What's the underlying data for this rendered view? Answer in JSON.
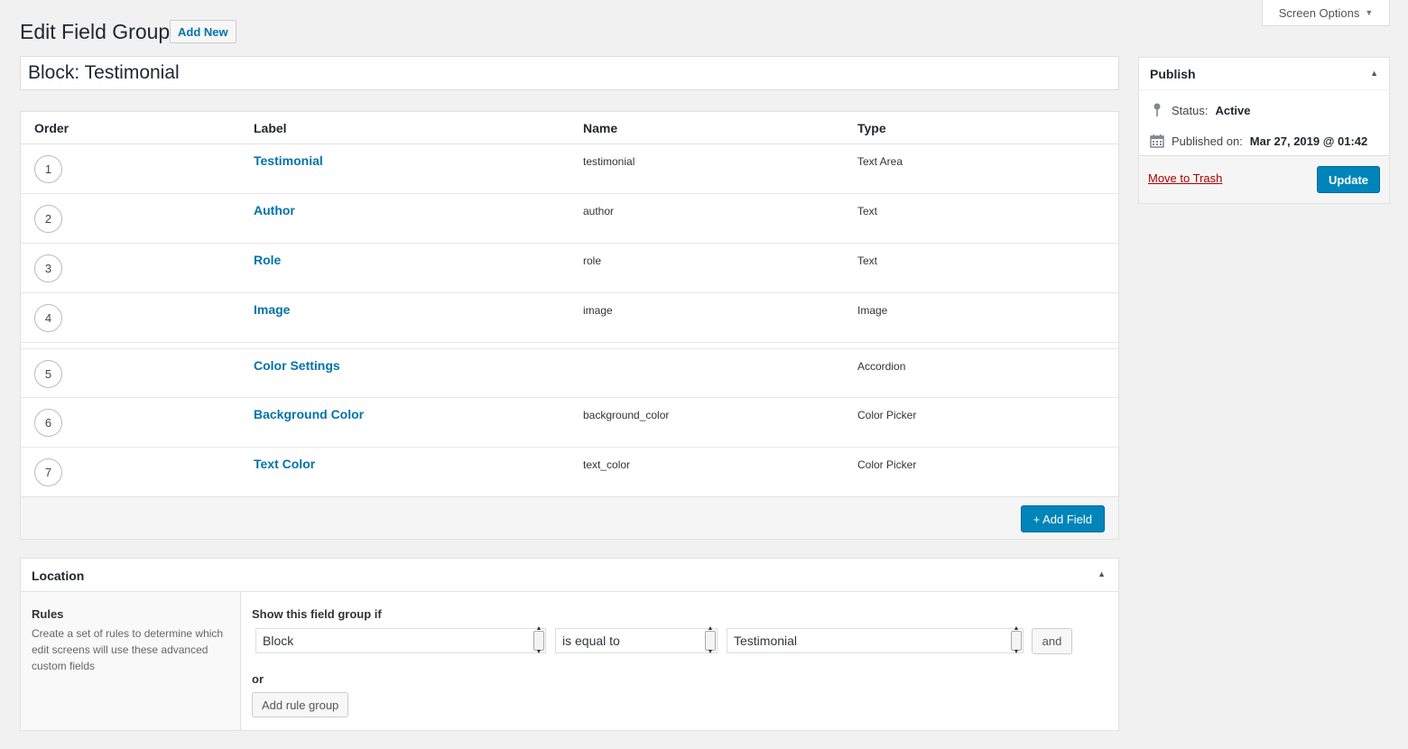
{
  "screen_options": {
    "label": "Screen Options",
    "caret": "▼"
  },
  "header": {
    "title": "Edit Field Group",
    "add_new": "Add New"
  },
  "title_input": {
    "value": "Block: Testimonial"
  },
  "fields": {
    "columns": {
      "order": "Order",
      "label": "Label",
      "name": "Name",
      "type": "Type"
    },
    "rows": [
      {
        "order": "1",
        "label": "Testimonial",
        "name": "testimonial",
        "type": "Text Area"
      },
      {
        "order": "2",
        "label": "Author",
        "name": "author",
        "type": "Text"
      },
      {
        "order": "3",
        "label": "Role",
        "name": "role",
        "type": "Text"
      },
      {
        "order": "4",
        "label": "Image",
        "name": "image",
        "type": "Image"
      },
      {
        "order": "5",
        "label": "Color Settings",
        "name": "",
        "type": "Accordion"
      },
      {
        "order": "6",
        "label": "Background Color",
        "name": "background_color",
        "type": "Color Picker"
      },
      {
        "order": "7",
        "label": "Text Color",
        "name": "text_color",
        "type": "Color Picker"
      }
    ],
    "add_field": "+ Add Field"
  },
  "location": {
    "title": "Location",
    "toggle": "▲",
    "rules_title": "Rules",
    "rules_desc": "Create a set of rules to determine which edit screens will use these advanced custom fields",
    "show_if": "Show this field group if",
    "param": "Block",
    "operator": "is equal to",
    "value": "Testimonial",
    "and": "and",
    "or": "or",
    "add_rule_group": "Add rule group"
  },
  "publish": {
    "title": "Publish",
    "toggle": "▲",
    "status_label": "Status:",
    "status_value": "Active",
    "published_label": "Published on:",
    "published_value": "Mar 27, 2019 @ 01:42",
    "move_to_trash": "Move to Trash",
    "update": "Update"
  },
  "colors": {
    "accent": "#0085ba",
    "link": "#0073aa",
    "trash": "#aa0000",
    "background": "#f1f1f1"
  }
}
